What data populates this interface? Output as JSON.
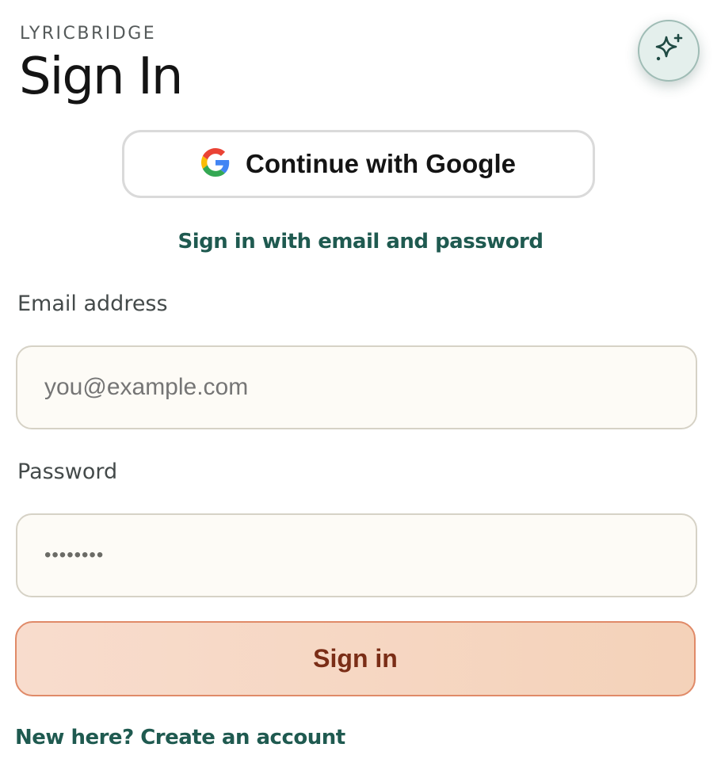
{
  "app": {
    "brand": "LYRICBRIDGE",
    "title": "Sign In"
  },
  "header": {
    "assistant_icon": "sparkle-icon"
  },
  "google": {
    "label": "Continue with Google",
    "icon": "google-icon"
  },
  "email_signin_link": "Sign in with email and password",
  "form": {
    "email": {
      "label": "Email address",
      "placeholder": "you@example.com",
      "value": ""
    },
    "password": {
      "label": "Password",
      "value": "••••••••"
    },
    "submit_label": "Sign in"
  },
  "footer": {
    "create_account_link": "New here? Create an account"
  },
  "colors": {
    "accent_green": "#1f5a50",
    "button_peach": "#f6d7c3",
    "button_text": "#7a2d16",
    "field_bg": "#fdfbf6"
  }
}
